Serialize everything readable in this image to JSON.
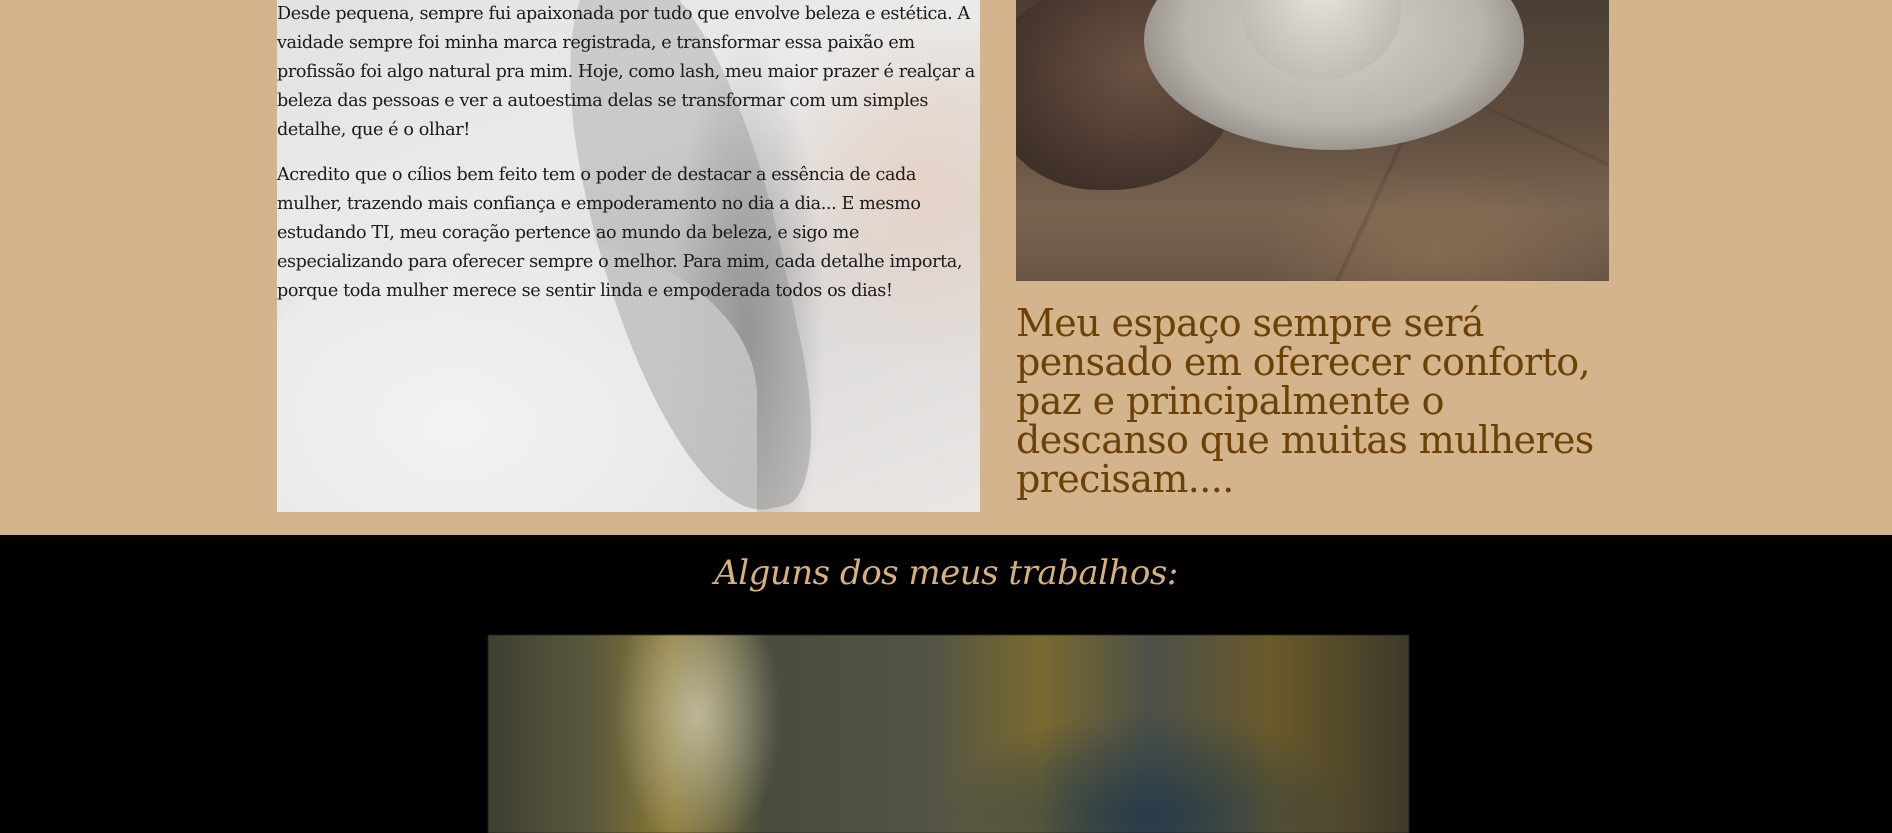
{
  "about": {
    "paragraphs": [
      "Desde pequena, sempre fui apaixonada por tudo que envolve beleza e estética. A vaidade sempre foi minha marca registrada, e transformar essa paixão em profissão foi algo natural pra mim. Hoje, como lash, meu maior prazer é realçar a beleza das pessoas e ver a autoestima delas se transformar com um simples detalhe, que é o olhar!",
      "Acredito que o cílios bem feito tem o poder de destacar a essência de cada mulher, trazendo mais confiança e empoderamento no dia a dia... E mesmo estudando TI, meu coração pertence ao mundo da beleza, e sigo me especializando para oferecer sempre o melhor. Para mim, cada detalhe importa, porque toda mulher merece se sentir linda e empoderada todos os dias!"
    ],
    "quote": "Meu espaço sempre será pensado em oferecer conforto, paz e principalmente o descanso que muitas mulheres precisam...."
  },
  "works": {
    "title": "Alguns dos meus trabalhos:"
  },
  "colors": {
    "page_background": "#d3b48c",
    "quote_text": "#6b4106",
    "works_background": "#000000",
    "works_title": "#d8b07b"
  }
}
